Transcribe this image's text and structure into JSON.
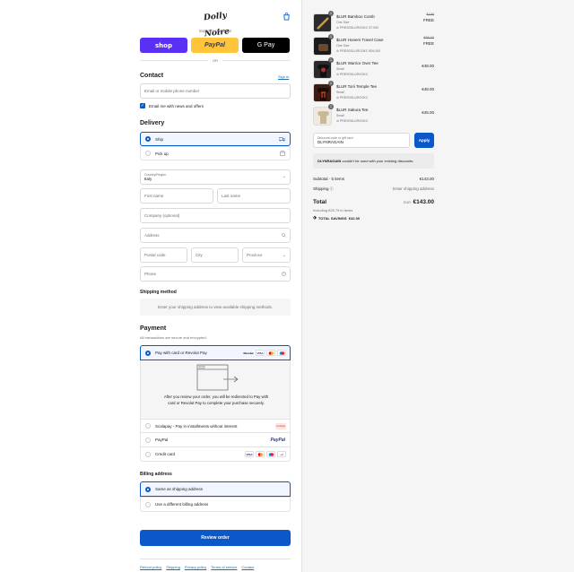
{
  "header": {
    "logo_text": "Dolly Noire"
  },
  "express": {
    "label": "Express checkout",
    "shop": "shop",
    "paypal": "PayPal",
    "gpay": "G Pay",
    "or": "OR"
  },
  "contact": {
    "title": "Contact",
    "sign_in": "Sign in",
    "email_placeholder": "Email or mobile phone number",
    "newsletter_label": "Email me with news and offers",
    "newsletter_checked": true
  },
  "delivery": {
    "title": "Delivery",
    "options": [
      {
        "label": "Ship",
        "selected": true
      },
      {
        "label": "Pick up",
        "selected": false
      }
    ],
    "country_label": "Country/Region",
    "country_value": "Italy",
    "first_name": "First name",
    "last_name": "Last name",
    "company": "Company (optional)",
    "address": "Address",
    "postal_code": "Postal code",
    "city": "City",
    "province": "Province",
    "phone": "Phone"
  },
  "shipping": {
    "title": "Shipping method",
    "message": "Enter your shipping address to view available shipping methods."
  },
  "payment": {
    "title": "Payment",
    "subtitle": "All transactions are secure and encrypted.",
    "options": [
      {
        "label": "Pay with card or Revolut Pay",
        "selected": true
      },
      {
        "label": "Scalapay - Pay in installments without interest",
        "selected": false
      },
      {
        "label": "PayPal",
        "selected": false
      },
      {
        "label": "Credit card",
        "selected": false
      }
    ],
    "redirect_text": "After you review your order, you will be redirected to Pay with card or Revolut Pay to complete your purchase securely.",
    "card_brands": [
      "Revolut",
      "VISA",
      "MC",
      "MC"
    ],
    "credit_brands": [
      "VISA",
      "MC",
      "MC",
      "+4"
    ],
    "paypal_brand": "PayPal",
    "scalapay_brand": "scalapay"
  },
  "billing": {
    "title": "Billing address",
    "options": [
      {
        "label": "Same as shipping address",
        "selected": true
      },
      {
        "label": "Use a different billing address",
        "selected": false
      }
    ]
  },
  "review_button": "Review order",
  "footer_links": [
    "Refund policy",
    "Shipping",
    "Privacy policy",
    "Terms of service",
    "Contact"
  ],
  "cart": {
    "items": [
      {
        "name": "$LUR Bamboo Comb",
        "size": "One Size",
        "code": "PRESSSLURGOKC €7,000",
        "old": "€158",
        "price": "FREE",
        "qty": "1",
        "color": "#2b2b2b"
      },
      {
        "name": "$LUR Honers Travel Case",
        "size": "One Size",
        "code": "PRESSSLURGOKC €09,000",
        "old": "€55,00",
        "price": "FREE",
        "qty": "1",
        "color": "#1b1b1b"
      },
      {
        "name": "$LUR Warrior Over Tee",
        "size": "Small",
        "code": "PRESSSLURGOKC",
        "old": "",
        "price": "€48.00",
        "qty": "1",
        "color": "#222"
      },
      {
        "name": "$LUR Torii Temple Tee",
        "size": "Small",
        "code": "PRESSSLURGOKC",
        "old": "",
        "price": "€48.00",
        "qty": "1",
        "color": "#3a1d14"
      },
      {
        "name": "$LUR Sakura Tee",
        "size": "Small",
        "code": "PRESSSLURGOKC",
        "old": "",
        "price": "€45.00",
        "qty": "1",
        "color": "#d8c9b0"
      }
    ],
    "discount_label": "Discount code or gift card",
    "discount_value": "DLYNRAGAIN",
    "apply": "Apply",
    "discount_error_code": "DLYNRAGAIN",
    "discount_error": "couldn't be used with your existing discounts.",
    "subtotal_label": "Subtotal · 5 items",
    "subtotal_value": "€143.00",
    "shipping_label": "Shipping",
    "shipping_value": "Enter shipping address",
    "total_label": "Total",
    "currency": "EUR",
    "total_value": "€143.00",
    "taxes": "Including €25.79 in taxes",
    "savings_label": "TOTAL SAVINGS",
    "savings_value": "€42.00"
  }
}
